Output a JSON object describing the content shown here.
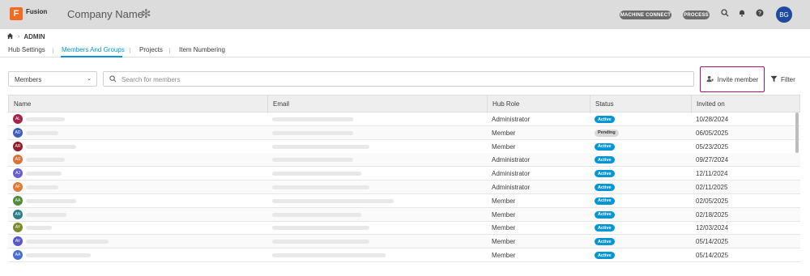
{
  "header": {
    "logo_letter": "F",
    "logo_text": "Fusion",
    "company": "Company Name",
    "buttons": [
      "MACHINE CONNECT",
      "PROCESS"
    ],
    "user_initials": "BG"
  },
  "breadcrumb": {
    "current": "ADMIN"
  },
  "tabs": [
    {
      "label": "Hub Settings"
    },
    {
      "label": "Members And Groups"
    },
    {
      "label": "Projects"
    },
    {
      "label": "Item Numbering"
    }
  ],
  "toolbar": {
    "select_value": "Members",
    "search_placeholder": "Search for members",
    "invite_label": "Invite member",
    "filter_label": "Filter"
  },
  "table": {
    "columns": [
      "Name",
      "Email",
      "Hub Role",
      "Status",
      "Invited on"
    ],
    "rows": [
      {
        "initials": "AL",
        "color": "#a3244b",
        "role": "Administrator",
        "status": "Active",
        "date": "10/28/2024"
      },
      {
        "initials": "AD",
        "color": "#3e5dbf",
        "role": "Member",
        "status": "Pending",
        "date": "06/05/2025"
      },
      {
        "initials": "AR",
        "color": "#8e1f2c",
        "role": "Member",
        "status": "Active",
        "date": "05/23/2025"
      },
      {
        "initials": "AS",
        "color": "#d9733a",
        "role": "Administrator",
        "status": "Active",
        "date": "09/27/2024"
      },
      {
        "initials": "AJ",
        "color": "#6a5fd1",
        "role": "Administrator",
        "status": "Active",
        "date": "12/11/2024"
      },
      {
        "initials": "AF",
        "color": "#e07a36",
        "role": "Administrator",
        "status": "Active",
        "date": "02/11/2025"
      },
      {
        "initials": "AA",
        "color": "#4f8c3a",
        "role": "Member",
        "status": "Active",
        "date": "02/05/2025"
      },
      {
        "initials": "AN",
        "color": "#2e7d8a",
        "role": "Member",
        "status": "Active",
        "date": "02/18/2025"
      },
      {
        "initials": "AY",
        "color": "#7a8a2c",
        "role": "Member",
        "status": "Active",
        "date": "12/03/2024"
      },
      {
        "initials": "AV",
        "color": "#5a55c8",
        "role": "Member",
        "status": "Active",
        "date": "05/14/2025"
      },
      {
        "initials": "AA",
        "color": "#4a6ecf",
        "role": "Member",
        "status": "Active",
        "date": "05/14/2025"
      }
    ]
  }
}
